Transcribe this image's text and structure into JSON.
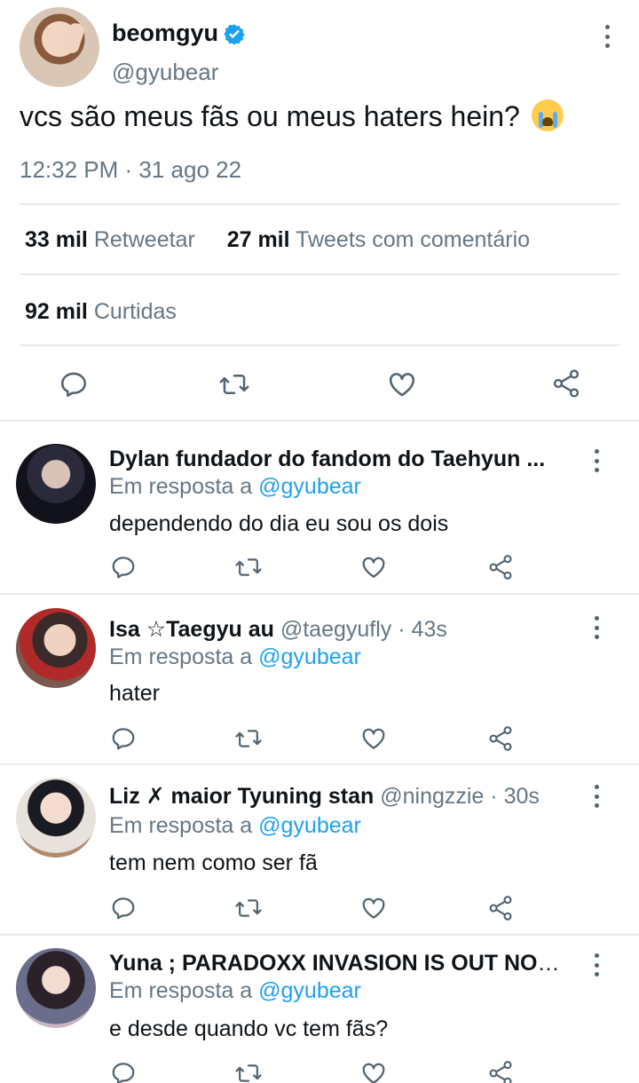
{
  "main_tweet": {
    "name": "beomgyu",
    "handle": "@gyubear",
    "text": "vcs são meus fãs ou meus haters hein?",
    "emoji": "loudly-crying-face",
    "timestamp": "12:32 PM · 31 ago 22",
    "stats": {
      "retweets_count": "33 mil",
      "retweets_label": "Retweetar",
      "quotes_count": "27 mil",
      "quotes_label": "Tweets com comentário",
      "likes_count": "92 mil",
      "likes_label": "Curtidas"
    },
    "actions": [
      "reply-icon",
      "retweet-icon",
      "like-icon",
      "share-icon"
    ]
  },
  "replies": [
    {
      "name": "Dylan fundador do fandom do Taehyun ...",
      "handle": "",
      "time": "",
      "in_reply_label": "Em resposta a",
      "in_reply_handle": "@gyubear",
      "text": "dependendo do dia eu sou os dois"
    },
    {
      "name": "Isa ☆Taegyu au",
      "handle": "@taegyufly",
      "time": "· 43s",
      "in_reply_label": "Em resposta a",
      "in_reply_handle": "@gyubear",
      "text": "hater"
    },
    {
      "name": "Liz ✗ maior Tyuning stan",
      "handle": "@ningzzie",
      "time": "· 30s",
      "in_reply_label": "Em resposta a",
      "in_reply_handle": "@gyubear",
      "text": "tem nem como ser fã"
    },
    {
      "name": "Yuna ; PARADOXX INVASION IS OUT NOW!...",
      "handle": "",
      "time": "",
      "in_reply_label": "Em resposta a",
      "in_reply_handle": "@gyubear",
      "text": "e desde quando vc tem fãs?"
    }
  ],
  "colors": {
    "accent": "#1da1f2",
    "secondary_text": "#657786",
    "divider": "#e6ecf0",
    "icon": "#536471"
  }
}
